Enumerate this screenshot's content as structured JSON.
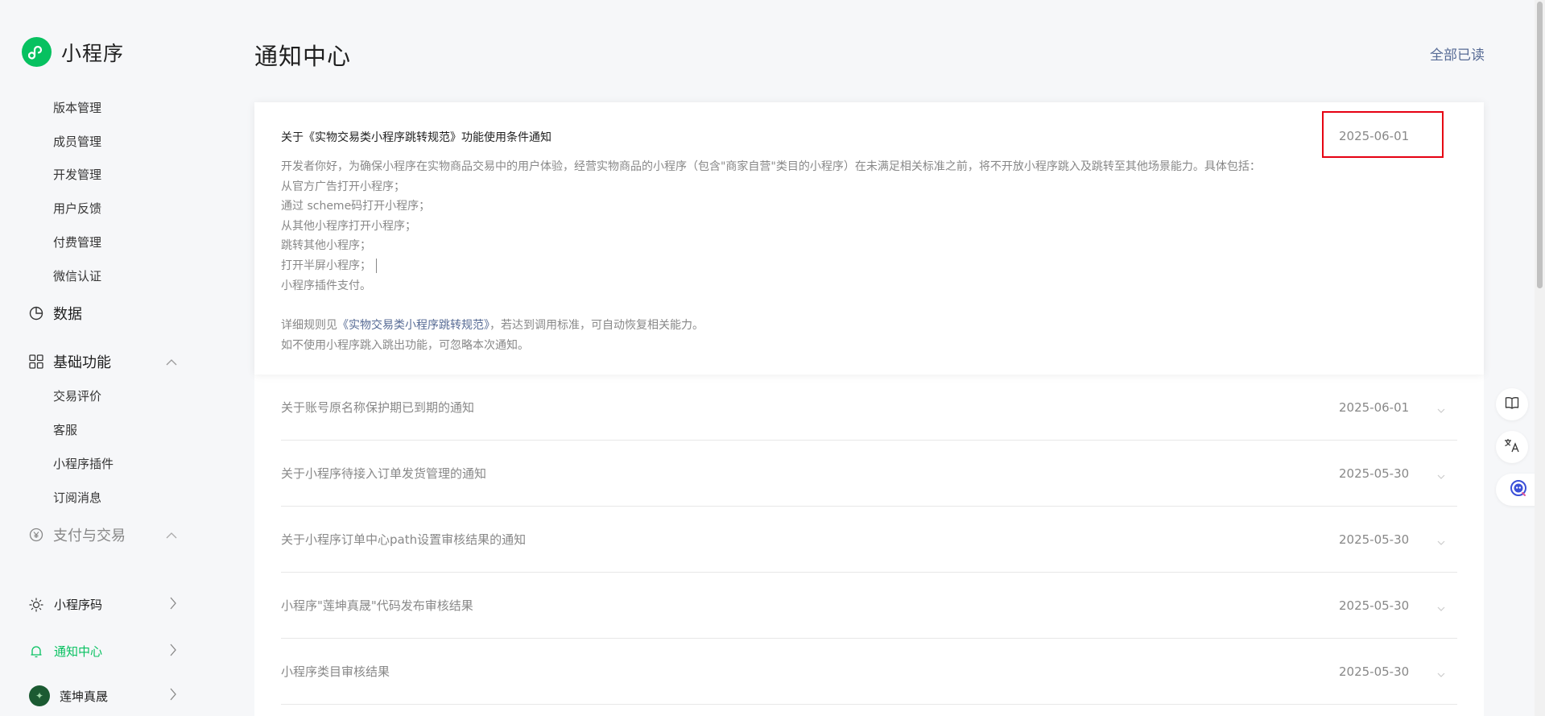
{
  "app": {
    "name": "小程序"
  },
  "sidebar": {
    "sub_items_top": [
      "版本管理",
      "成员管理",
      "开发管理",
      "用户反馈",
      "付费管理",
      "微信认证"
    ],
    "groups": {
      "data": "数据",
      "basic": "基础功能",
      "payment": "支付与交易"
    },
    "basic_items": [
      "交易评价",
      "客服",
      "小程序插件",
      "订阅消息"
    ],
    "bottom": {
      "qrcode": "小程序码",
      "notifications": "通知中心",
      "account": "莲坤真晟"
    }
  },
  "page": {
    "title": "通知中心",
    "mark_all_read": "全部已读"
  },
  "expanded": {
    "title": "关于《实物交易类小程序跳转规范》功能使用条件通知",
    "date": "2025-06-01",
    "intro": "开发者你好，为确保小程序在实物商品交易中的用户体验，经营实物商品的小程序（包含\"商家自营\"类目的小程序）在未满足相关标准之前，将不开放小程序跳入及跳转至其他场景能力。具体包括：",
    "items": [
      "从官方广告打开小程序；",
      "通过 scheme码打开小程序；",
      "从其他小程序打开小程序；",
      "跳转其他小程序；",
      "打开半屏小程序；",
      "小程序插件支付。"
    ],
    "detail_prefix": "详细规则见",
    "detail_link": "《实物交易类小程序跳转规范》",
    "detail_suffix": "，若达到调用标准，可自动恢复相关能力。",
    "ignore": "如不使用小程序跳入跳出功能，可忽略本次通知。"
  },
  "notices": [
    {
      "title": "关于账号原名称保护期已到期的通知",
      "date": "2025-06-01"
    },
    {
      "title": "关于小程序待接入订单发货管理的通知",
      "date": "2025-05-30"
    },
    {
      "title": "关于小程序订单中心path设置审核结果的通知",
      "date": "2025-05-30"
    },
    {
      "title": "小程序\"莲坤真晟\"代码发布审核结果",
      "date": "2025-05-30"
    },
    {
      "title": "小程序类目审核结果",
      "date": "2025-05-30"
    }
  ],
  "colors": {
    "brand_green": "#07c160",
    "link_blue": "#576b95",
    "highlight_red": "#e60012"
  }
}
